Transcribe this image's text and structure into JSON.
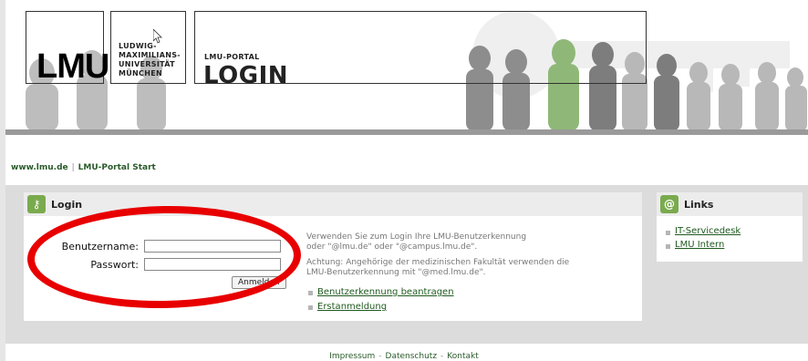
{
  "header": {
    "logo_text": "LMU",
    "university_lines": [
      "LUDWIG-",
      "MAXIMILIANS-",
      "UNIVERSITÄT",
      "MÜNCHEN"
    ],
    "portal_small": "LMU-PORTAL",
    "portal_big": "LOGIN"
  },
  "nav": {
    "home_link": "www.lmu.de",
    "separator": "|",
    "portal_start_link": "LMU-Portal Start"
  },
  "login": {
    "title": "Login",
    "username_label": "Benutzername:",
    "username_value": "",
    "password_label": "Passwort:",
    "password_value": "",
    "submit_label": "Anmelden",
    "info_line1": "Verwenden Sie zum Login Ihre LMU-Benutzerkennung",
    "info_line2": "oder \"@lmu.de\" oder \"@campus.lmu.de\".",
    "info_line3": "Achtung: Angehörige der medizinischen Fakultät verwenden die",
    "info_line4": "LMU-Benutzerkennung mit \"@med.lmu.de\".",
    "link_apply": "Benutzerkennung beantragen",
    "link_first_login": "Erstanmeldung"
  },
  "links_panel": {
    "title": "Links",
    "items": [
      "IT-Servicedesk",
      "LMU Intern"
    ]
  },
  "footer": {
    "impressum": "Impressum",
    "datenschutz": "Datenschutz",
    "kontakt": "Kontakt",
    "separator": "-"
  },
  "colors": {
    "accent_green": "#2a5b2a",
    "icon_green": "#7aaa4e",
    "highlight_red": "#e80000"
  }
}
